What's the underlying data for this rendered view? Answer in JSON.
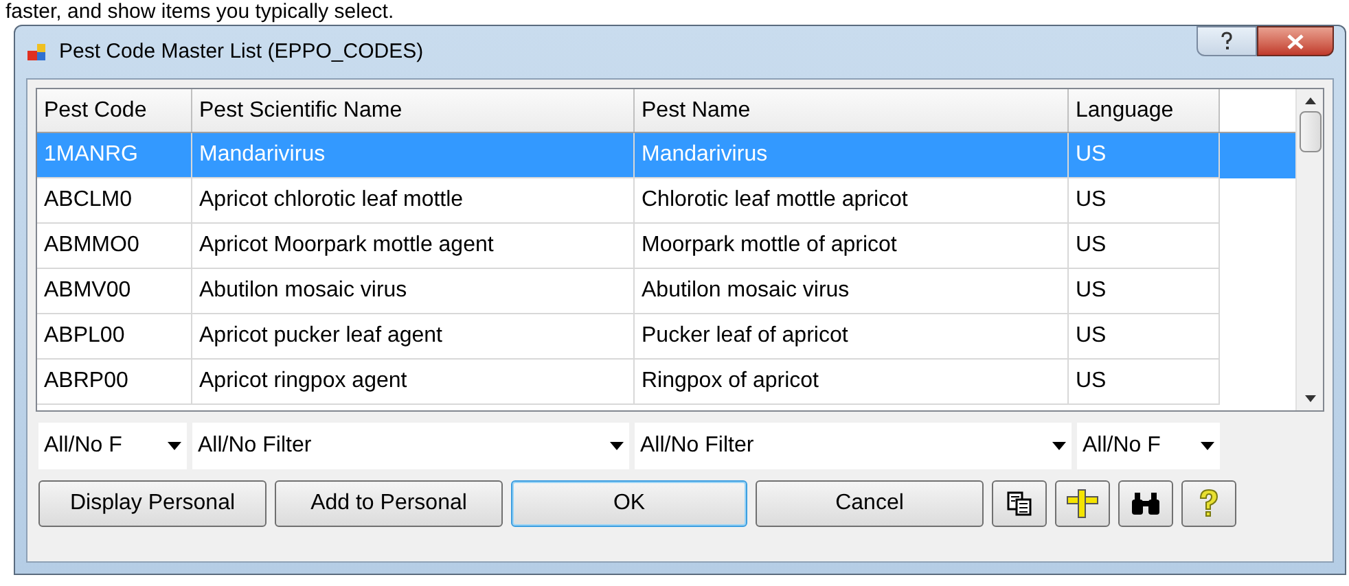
{
  "caption": "faster, and show items you typically select.",
  "window": {
    "title": "Pest Code Master List (EPPO_CODES)"
  },
  "table": {
    "columns": [
      "Pest Code",
      "Pest Scientific Name",
      "Pest Name",
      "Language"
    ],
    "rows": [
      {
        "cells": [
          "1MANRG",
          "Mandarivirus",
          "Mandarivirus",
          "US"
        ],
        "selected": true
      },
      {
        "cells": [
          "ABCLM0",
          "Apricot chlorotic leaf mottle",
          "Chlorotic leaf mottle apricot",
          "US"
        ],
        "selected": false
      },
      {
        "cells": [
          "ABMMO0",
          "Apricot Moorpark mottle agent",
          "Moorpark mottle of apricot",
          "US"
        ],
        "selected": false
      },
      {
        "cells": [
          "ABMV00",
          "Abutilon mosaic virus",
          "Abutilon mosaic virus",
          "US"
        ],
        "selected": false
      },
      {
        "cells": [
          "ABPL00",
          "Apricot pucker leaf agent",
          "Pucker leaf of apricot",
          "US"
        ],
        "selected": false
      },
      {
        "cells": [
          "ABRP00",
          "Apricot ringpox agent",
          "Ringpox of apricot",
          "US"
        ],
        "selected": false
      }
    ]
  },
  "filters": [
    "All/No F",
    "All/No Filter",
    "All/No Filter",
    "All/No F"
  ],
  "buttons": [
    {
      "kind": "text",
      "label": "Display Personal",
      "default": false
    },
    {
      "kind": "text",
      "label": "Add to Personal",
      "default": false
    },
    {
      "kind": "text",
      "label": "OK",
      "default": true
    },
    {
      "kind": "text",
      "label": "Cancel",
      "default": false
    },
    {
      "kind": "copy"
    },
    {
      "kind": "ruler"
    },
    {
      "kind": "binoculars"
    },
    {
      "kind": "help"
    }
  ]
}
